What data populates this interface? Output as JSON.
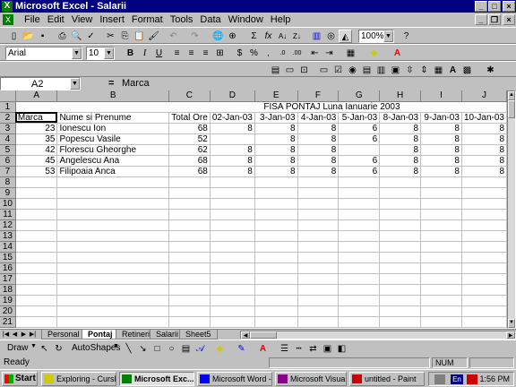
{
  "window": {
    "title": "Microsoft Excel - Salarii",
    "min": "_",
    "max": "□",
    "close": "×"
  },
  "menu": [
    "File",
    "Edit",
    "View",
    "Insert",
    "Format",
    "Tools",
    "Data",
    "Window",
    "Help"
  ],
  "formatting": {
    "font": "Arial",
    "size": "10",
    "zoom": "100%"
  },
  "formula_bar": {
    "cell_ref": "A2",
    "eq": "=",
    "content": "Marca"
  },
  "columns": [
    "A",
    "B",
    "C",
    "D",
    "E",
    "F",
    "G",
    "H",
    "I",
    "J"
  ],
  "rows": [
    [
      "",
      "",
      "",
      "",
      "",
      "",
      "",
      "",
      "",
      ""
    ],
    [
      "Marca",
      "Nume si Prenume",
      "Total Ore",
      "02-Jan-03",
      "3-Jan-03",
      "4-Jan-03",
      "5-Jan-03",
      "8-Jan-03",
      "9-Jan-03",
      "10-Jan-03"
    ],
    [
      "23",
      "Ionescu Ion",
      "68",
      "8",
      "8",
      "8",
      "6",
      "8",
      "8",
      "8"
    ],
    [
      "35",
      "Popescu Vasile",
      "52",
      "",
      "8",
      "8",
      "6",
      "8",
      "8",
      "8"
    ],
    [
      "42",
      "Florescu Gheorghe",
      "62",
      "8",
      "8",
      "8",
      "",
      "8",
      "8",
      "8"
    ],
    [
      "45",
      "Angelescu Ana",
      "68",
      "8",
      "8",
      "8",
      "6",
      "8",
      "8",
      "8"
    ],
    [
      "53",
      "Filipoaia Anca",
      "68",
      "8",
      "8",
      "8",
      "6",
      "8",
      "8",
      "8"
    ]
  ],
  "sheet_title": "FISA PONTAJ Luna Ianuarie 2003",
  "row_count": 21,
  "sheet_tabs": [
    "Personal",
    "Pontaj",
    "Retineri",
    "Salarii",
    "Sheet5"
  ],
  "active_tab": "Pontaj",
  "drawing": {
    "draw": "Draw",
    "autoshapes": "AutoShapes"
  },
  "status": {
    "ready": "Ready",
    "num": "NUM"
  },
  "taskbar": {
    "start": "Start",
    "tasks": [
      "Exploring - CursL...",
      "Microsoft Exc...",
      "Microsoft Word -...",
      "Microsoft Visual...",
      "untitled - Paint"
    ],
    "lang": "En",
    "clock": "1:56 PM"
  }
}
